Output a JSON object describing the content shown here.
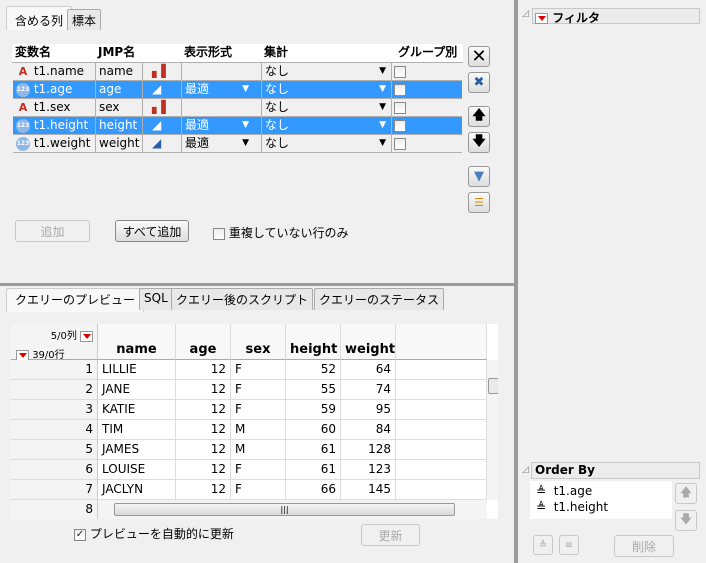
{
  "columns_tabs": [
    "含める列",
    "標本"
  ],
  "columns_table": {
    "headers": [
      "変数名",
      "JMP名",
      "",
      "表示形式",
      "集計",
      "グループ別"
    ],
    "rows": [
      {
        "var": "t1.name",
        "jmp": "name",
        "type": "character",
        "format": "",
        "agg": "なし",
        "selected": false
      },
      {
        "var": "t1.age",
        "jmp": "age",
        "type": "numeric",
        "format": "最適",
        "agg": "なし",
        "selected": true
      },
      {
        "var": "t1.sex",
        "jmp": "sex",
        "type": "character",
        "format": "",
        "agg": "なし",
        "selected": false
      },
      {
        "var": "t1.height",
        "jmp": "height",
        "type": "numeric",
        "format": "最適",
        "agg": "なし",
        "selected": true
      },
      {
        "var": "t1.weight",
        "jmp": "weight",
        "type": "numeric",
        "format": "最適",
        "agg": "なし",
        "selected": false
      }
    ]
  },
  "buttons": {
    "add": "追加",
    "add_all": "すべて追加",
    "distinct_only": "重複していない行のみ",
    "refresh": "更新",
    "delete": "削除",
    "auto_update": "プレビューを自動的に更新"
  },
  "preview_tabs": [
    "クエリーのプレビュー",
    "SQL",
    "クエリー後のスクリプト",
    "クエリーのステータス"
  ],
  "preview": {
    "col_count": "5/0列",
    "row_count": "39/0行",
    "headers": [
      "name",
      "age",
      "sex",
      "height",
      "weight"
    ],
    "rows": [
      [
        "1",
        "LILLIE",
        "12",
        "F",
        "52",
        "64"
      ],
      [
        "2",
        "JANE",
        "12",
        "F",
        "55",
        "74"
      ],
      [
        "3",
        "KATIE",
        "12",
        "F",
        "59",
        "95"
      ],
      [
        "4",
        "TIM",
        "12",
        "M",
        "60",
        "84"
      ],
      [
        "5",
        "JAMES",
        "12",
        "M",
        "61",
        "128"
      ],
      [
        "6",
        "LOUISE",
        "12",
        "F",
        "61",
        "123"
      ],
      [
        "7",
        "JACLYN",
        "12",
        "F",
        "66",
        "145"
      ],
      [
        "8",
        "",
        "",
        "",
        "",
        ""
      ]
    ]
  },
  "filter": {
    "title": "フィルタ"
  },
  "order_by": {
    "title": "Order By",
    "items": [
      "t1.age",
      "t1.height"
    ]
  }
}
